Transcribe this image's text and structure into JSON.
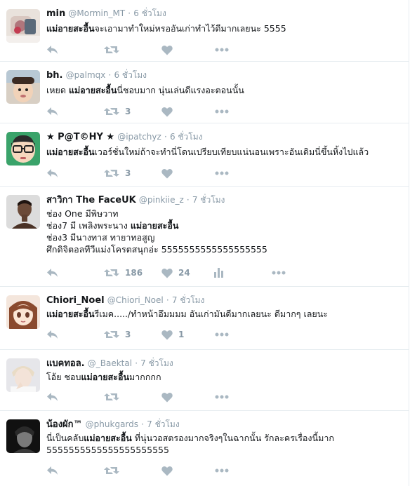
{
  "tweets": [
    {
      "name": "min",
      "handle": "@Mormin_MT",
      "time": "6 ชั่วโมง",
      "lines": [
        [
          {
            "t": "แม่อายสะอื้น",
            "b": true
          },
          {
            "t": "จะเอามาทำใหม่หรออันเก่าทำไว้ดีมากเลยนะ 5555",
            "b": false
          }
        ]
      ],
      "retweets": "",
      "likes": "",
      "analytics": false
    },
    {
      "name": "bh.",
      "handle": "@palmqx",
      "time": "6 ชั่วโมง",
      "lines": [
        [
          {
            "t": "เหยด ",
            "b": false
          },
          {
            "t": "แม่อายสะอื้น",
            "b": true
          },
          {
            "t": "นี่ชอบมาก นุ่นเล่นดีแรงอะตอนนั้น",
            "b": false
          }
        ]
      ],
      "retweets": "3",
      "likes": "",
      "analytics": false
    },
    {
      "name": "★ P@T©HY ★",
      "handle": "@ipatchyz",
      "time": "6 ชั่วโมง",
      "lines": [
        [
          {
            "t": "แม่อายสะอื้น",
            "b": true
          },
          {
            "t": "เวอร์ชั่นใหม่ถ้าจะทำนี่โดนเปรียบเทียบแน่นอนเพราะอันเดิมนี่ขึ้นหิ้งไปแล้ว",
            "b": false
          }
        ]
      ],
      "retweets": "3",
      "likes": "",
      "analytics": false
    },
    {
      "name": "สาวิกา The FaceUK",
      "handle": "@pinkiie_z",
      "time": "7 ชั่วโมง",
      "lines": [
        [
          {
            "t": "ช่อง One มีพิษวาท",
            "b": false
          }
        ],
        [
          {
            "t": "ช่อง7 มี เพลิงพระนาง ",
            "b": false
          },
          {
            "t": "แม่อายสะอื้น",
            "b": true
          }
        ],
        [
          {
            "t": "ช่อง3 มีนางทาส ทายาทอสูญ",
            "b": false
          }
        ],
        [
          {
            "t": "ศึกดิจิตอลทีวีแม่งโครตสนุกอ่ะ 5555555555555555555",
            "b": false
          }
        ]
      ],
      "retweets": "186",
      "likes": "24",
      "analytics": true
    },
    {
      "name": "Chiori_Noel",
      "handle": "@Chiori_Noel",
      "time": "7 ชั่วโมง",
      "lines": [
        [
          {
            "t": "แม่อายสะอื้น",
            "b": true
          },
          {
            "t": "รีเมค...../ทำหน้าอึมมมม อันเก่ามันดีมากเลยนะ ดีมากๆ เลยนะ",
            "b": false
          }
        ]
      ],
      "retweets": "3",
      "likes": "1",
      "analytics": false
    },
    {
      "name": "แบคทอล.",
      "handle": "@_Baektal",
      "time": "7 ชั่วโมง",
      "lines": [
        [
          {
            "t": "โอ้ย ชอบ",
            "b": false
          },
          {
            "t": "แม่อายสะอื้น",
            "b": true
          },
          {
            "t": "มากกกก",
            "b": false
          }
        ]
      ],
      "retweets": "",
      "likes": "",
      "analytics": false
    },
    {
      "name": "น้องผัก™",
      "handle": "@phukgards",
      "time": "7 ชั่วโมง",
      "lines": [
        [
          {
            "t": "นี่เป็นคลับ",
            "b": false
          },
          {
            "t": "แม่อายสะอื้น",
            "b": true
          },
          {
            "t": " ที่นุ่นวอสตรองมากจริงๆในฉากนั้น รักละครเรื่องนี้มาก",
            "b": false
          }
        ],
        [
          {
            "t": "5555555555555555555555",
            "b": false
          }
        ]
      ],
      "retweets": "",
      "likes": "",
      "analytics": false
    }
  ]
}
